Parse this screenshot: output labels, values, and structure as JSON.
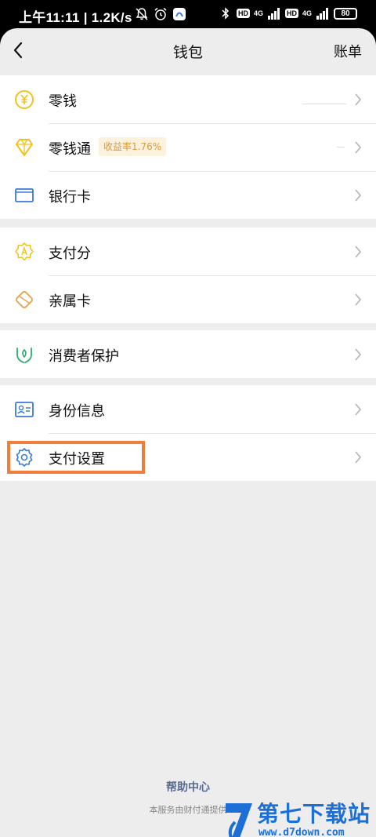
{
  "status_bar": {
    "time": "上午11:11 | 1.2K/s",
    "network_1": "4G",
    "network_2": "4G",
    "hd_1": "HD",
    "hd_2": "HD",
    "battery": "80"
  },
  "nav": {
    "title": "钱包",
    "right_link": "账单"
  },
  "groups": [
    {
      "items": [
        {
          "label": "零钱",
          "icon": "coin-yen-icon"
        },
        {
          "label": "零钱通",
          "icon": "diamond-icon",
          "badge": "收益率1.76%"
        },
        {
          "label": "银行卡",
          "icon": "bank-card-icon"
        }
      ]
    },
    {
      "items": [
        {
          "label": "支付分",
          "icon": "credit-score-icon"
        },
        {
          "label": "亲属卡",
          "icon": "family-card-icon"
        }
      ]
    },
    {
      "items": [
        {
          "label": "消费者保护",
          "icon": "consumer-protection-icon"
        }
      ]
    },
    {
      "items": [
        {
          "label": "身份信息",
          "icon": "id-card-icon"
        },
        {
          "label": "支付设置",
          "icon": "gear-icon"
        }
      ]
    }
  ],
  "footer": {
    "help_center": "帮助中心",
    "note": "本服务由财付通提供"
  },
  "watermark": {
    "title": "第七下载站",
    "url": "www.d7down.com"
  },
  "colors": {
    "accent_yellow": "#f2c21b",
    "accent_green": "#2bae66",
    "accent_blue": "#3a7bd5",
    "highlight": "#ef7d3c",
    "watermark_blue": "#1b6fd6"
  }
}
